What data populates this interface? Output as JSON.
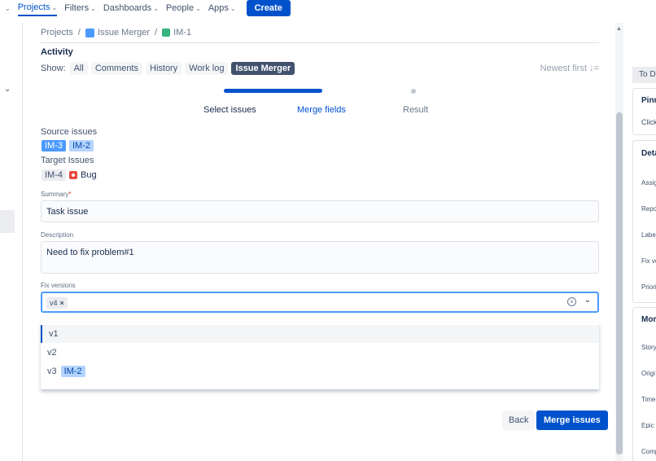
{
  "topbar": {
    "nav": [
      {
        "label": "Projects",
        "active": true
      },
      {
        "label": "Filters"
      },
      {
        "label": "Dashboards"
      },
      {
        "label": "People"
      },
      {
        "label": "Apps"
      }
    ],
    "create_label": "Create"
  },
  "breadcrumb": {
    "project": "Projects",
    "board": "Issue Merger",
    "issue": "IM-1"
  },
  "activity": {
    "title": "Activity",
    "show_label": "Show:",
    "filters": [
      "All",
      "Comments",
      "History",
      "Work log",
      "Issue Merger"
    ],
    "active_filter": "Issue Merger",
    "sort": "Newest first ↓="
  },
  "steps": [
    "Select issues",
    "Merge fields",
    "Result"
  ],
  "source": {
    "label": "Source issues",
    "issues": [
      "IM-3",
      "IM-2"
    ]
  },
  "target": {
    "label": "Target Issues",
    "issue": "IM-4",
    "type": "Bug"
  },
  "summary": {
    "label": "Summary",
    "required_mark": "*",
    "value": "Task issue"
  },
  "description": {
    "label": "Description",
    "value": "Need to fix problem#1"
  },
  "fix_versions": {
    "label": "Fix versions",
    "selected": "v4",
    "remove_glyph": "×",
    "options": [
      {
        "label": "v1",
        "tag": ""
      },
      {
        "label": "v2",
        "tag": ""
      },
      {
        "label": "v3",
        "tag": "IM-2"
      }
    ]
  },
  "actions": {
    "back": "Back",
    "merge": "Merge issues"
  },
  "right_panel": {
    "status": "To D",
    "pinned_title": "Pinn",
    "pinned_text": "Click",
    "details_title": "Deta",
    "details_items": [
      "Assig",
      "Repo",
      "Label",
      "Fix ve",
      "Priori"
    ],
    "more_title": "Mor",
    "more_items": [
      "Story",
      "Origi",
      "Time",
      "Epic L",
      "Comp"
    ]
  },
  "colors": {
    "accent": "#0052cc",
    "active_filter_bg": "#42526e",
    "lozenge_blue": "#4c9aff",
    "lozenge_light": "#b3d4ff",
    "bug_red": "#e5493a",
    "story_green": "#36b37e"
  }
}
